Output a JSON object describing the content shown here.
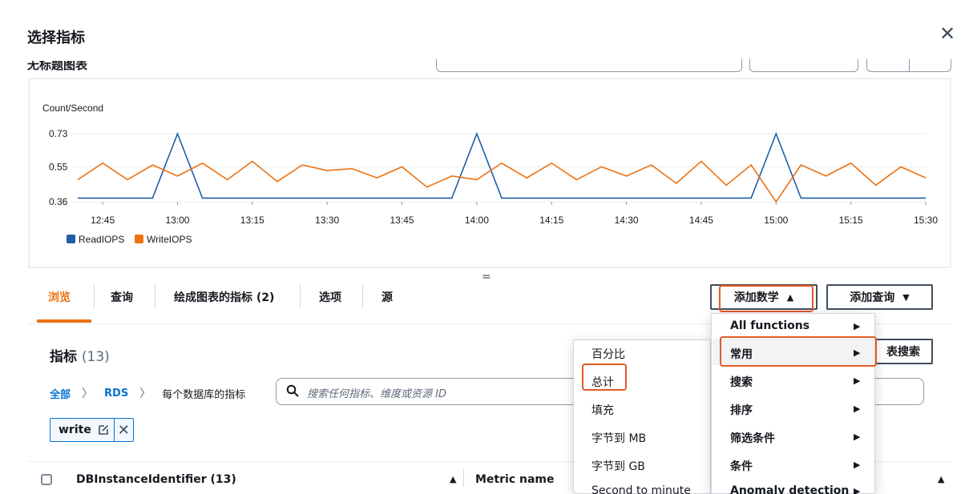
{
  "modal": {
    "title": "选择指标",
    "partial_title": "无标题图表"
  },
  "chart_data": {
    "type": "line",
    "ylabel": "Count/Second",
    "y_ticks": [
      0.73,
      0.55,
      0.36
    ],
    "ylim": [
      0.36,
      0.73
    ],
    "x_tick_labels": [
      "12:45",
      "13:00",
      "13:15",
      "13:30",
      "13:45",
      "14:00",
      "14:15",
      "14:30",
      "14:45",
      "15:00",
      "15:15",
      "15:30"
    ],
    "x": [
      "12:40",
      "12:45",
      "12:50",
      "12:55",
      "13:00",
      "13:05",
      "13:10",
      "13:15",
      "13:20",
      "13:25",
      "13:30",
      "13:35",
      "13:40",
      "13:45",
      "13:50",
      "13:55",
      "14:00",
      "14:05",
      "14:10",
      "14:15",
      "14:20",
      "14:25",
      "14:30",
      "14:35",
      "14:40",
      "14:45",
      "14:50",
      "14:55",
      "15:00",
      "15:05",
      "15:10",
      "15:15",
      "15:20",
      "15:25",
      "15:30"
    ],
    "series": [
      {
        "name": "ReadIOPS",
        "color": "#1f5fa8",
        "values": [
          0.38,
          0.38,
          0.38,
          0.38,
          0.73,
          0.38,
          0.38,
          0.38,
          0.38,
          0.38,
          0.38,
          0.38,
          0.38,
          0.38,
          0.38,
          0.38,
          0.73,
          0.38,
          0.38,
          0.38,
          0.38,
          0.38,
          0.38,
          0.38,
          0.38,
          0.38,
          0.38,
          0.38,
          0.73,
          0.38,
          0.38,
          0.38,
          0.38,
          0.38,
          0.38
        ]
      },
      {
        "name": "WriteIOPS",
        "color": "#ec7211",
        "values": [
          0.48,
          0.57,
          0.48,
          0.56,
          0.5,
          0.57,
          0.48,
          0.58,
          0.47,
          0.56,
          0.53,
          0.54,
          0.49,
          0.55,
          0.44,
          0.5,
          0.48,
          0.57,
          0.49,
          0.57,
          0.48,
          0.55,
          0.5,
          0.56,
          0.46,
          0.58,
          0.45,
          0.56,
          0.36,
          0.56,
          0.5,
          0.57,
          0.45,
          0.55,
          0.49
        ]
      }
    ],
    "legend": "bottom-left",
    "grid": true
  },
  "tabs": [
    {
      "label": "浏览"
    },
    {
      "label": "查询"
    },
    {
      "label": "绘成图表的指标 (2)"
    },
    {
      "label": "选项"
    },
    {
      "label": "源"
    }
  ],
  "buttons": {
    "add_math": "添加数学",
    "add_query": "添加查询",
    "graph_search": "表搜索"
  },
  "metrics": {
    "heading": "指标",
    "count": "(13)",
    "breadcrumb": [
      "全部",
      "RDS",
      "每个数据库的指标"
    ],
    "search_placeholder": "搜索任何指标、维度或资源 ID",
    "filter_token": "write"
  },
  "table": {
    "col_db_instance": "DBInstanceIdentifier (13)",
    "col_metric_name": "Metric name"
  },
  "math_menu": [
    {
      "label": "All functions"
    },
    {
      "label": "常用"
    },
    {
      "label": "搜索"
    },
    {
      "label": "排序"
    },
    {
      "label": "筛选条件"
    },
    {
      "label": "条件"
    },
    {
      "label": "Anomaly detection"
    }
  ],
  "submenu": [
    {
      "label": "百分比"
    },
    {
      "label": "总计"
    },
    {
      "label": "填充"
    },
    {
      "label": "字节到 MB"
    },
    {
      "label": "字节到 GB"
    },
    {
      "label": "Second to minute"
    }
  ]
}
